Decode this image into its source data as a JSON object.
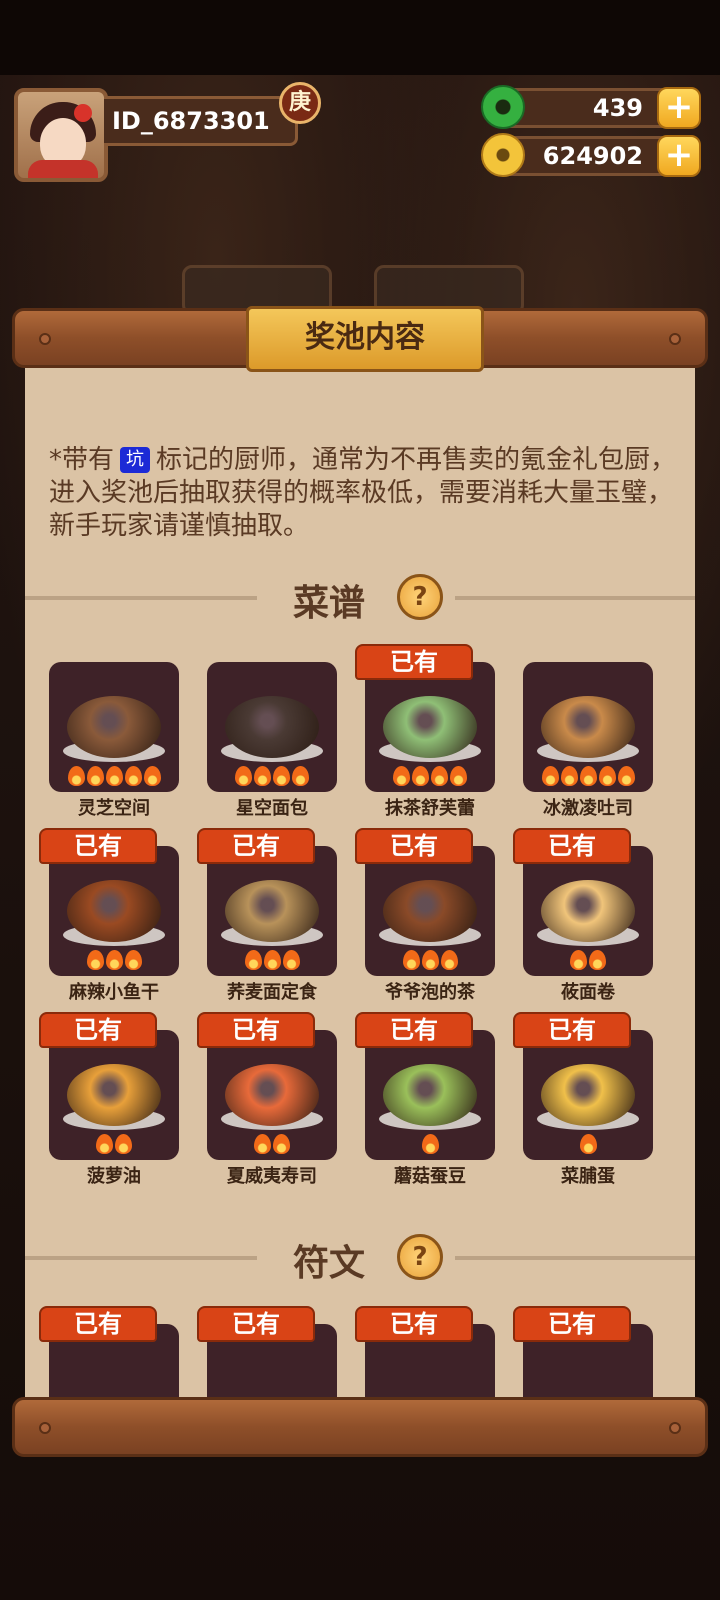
{
  "player": {
    "id": "ID_6873301",
    "grade": "庚"
  },
  "currencies": {
    "jade": "439",
    "coins": "624902",
    "plus": "+"
  },
  "panel": {
    "title": "奖池内容",
    "notice_prefix": "*带有",
    "notice_tag": "坑",
    "notice_text": "标记的厨师，通常为不再售卖的氪金礼包厨，进入奖池后抽取获得的概率极低，需要消耗大量玉璧，新手玩家请谨慎抽取。",
    "owned_label": "已有",
    "help_mark": "?"
  },
  "sections": {
    "recipes": "菜谱",
    "runes": "符文"
  },
  "recipes": [
    {
      "name": "灵芝空间",
      "flames": 5,
      "owned": false,
      "color": "#8a5a3a"
    },
    {
      "name": "星空面包",
      "flames": 4,
      "owned": false,
      "color": "#4a3a34"
    },
    {
      "name": "抹茶舒芙蕾",
      "flames": 4,
      "owned": true,
      "color": "#8fbf76"
    },
    {
      "name": "冰激凌吐司",
      "flames": 5,
      "owned": false,
      "color": "#c98a4a"
    },
    {
      "name": "麻辣小鱼干",
      "flames": 3,
      "owned": true,
      "color": "#9a4a22"
    },
    {
      "name": "荞麦面定食",
      "flames": 3,
      "owned": true,
      "color": "#b8925a"
    },
    {
      "name": "爷爷泡的茶",
      "flames": 3,
      "owned": true,
      "color": "#8a4a28"
    },
    {
      "name": "莜面卷",
      "flames": 2,
      "owned": true,
      "color": "#f0c47a"
    },
    {
      "name": "菠萝油",
      "flames": 2,
      "owned": true,
      "color": "#e8a03a"
    },
    {
      "name": "夏威夷寿司",
      "flames": 2,
      "owned": true,
      "color": "#e86a3a"
    },
    {
      "name": "蘑菇蚕豆",
      "flames": 1,
      "owned": true,
      "color": "#9ac05a"
    },
    {
      "name": "菜脯蛋",
      "flames": 1,
      "owned": true,
      "color": "#f0c04a"
    }
  ]
}
